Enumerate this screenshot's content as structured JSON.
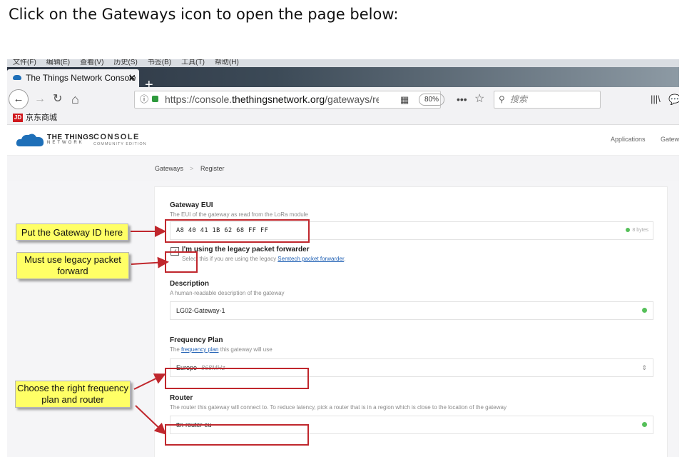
{
  "doc": {
    "heading": "Click on the Gateways icon to open the page below:"
  },
  "browser": {
    "menu": [
      "文件(F)",
      "编辑(E)",
      "查看(V)",
      "历史(S)",
      "书签(B)",
      "工具(T)",
      "帮助(H)"
    ],
    "tab": {
      "title": "The Things Network Console",
      "close": "✕"
    },
    "new_tab": "+",
    "back": "←",
    "forward": "→",
    "reload": "↻",
    "home": "⌂",
    "url": {
      "prefix": "https://console.",
      "domain": "thethingsnetwork.org",
      "path": "/gateways/regist"
    },
    "qr": "▦",
    "zoom": "80%",
    "more": "•••",
    "star": "☆",
    "search_placeholder": "搜索",
    "library": "|||\\",
    "chat": "💬",
    "bookmark": {
      "icon": "JD",
      "label": "京东商城"
    }
  },
  "header": {
    "logo_line1": "THE THINGS",
    "logo_line2": "NETWORK",
    "console": "CONSOLE",
    "edition": "COMMUNITY EDITION",
    "nav_applications": "Applications",
    "nav_gateways": "Gatew"
  },
  "breadcrumb": {
    "item1": "Gateways",
    "sep": ">",
    "item2": "Register"
  },
  "form": {
    "eui": {
      "title": "Gateway EUI",
      "desc": "The EUI of the gateway as read from the LoRa module",
      "value": "A8 40 41 1B 62 68 FF FF",
      "bytes": "8 bytes"
    },
    "legacy": {
      "check": "✓",
      "label": "I'm using the legacy packet forwarder",
      "desc_prefix": "Select this if you are using the legacy ",
      "desc_link": "Semtech packet forwarder",
      "desc_suffix": "."
    },
    "description": {
      "title": "Description",
      "desc": "A human-readable description of the gateway",
      "value": "LG02-Gateway-1"
    },
    "frequency": {
      "title": "Frequency Plan",
      "desc_prefix": "The ",
      "desc_link": "frequency plan",
      "desc_suffix": " this gateway will use",
      "value": "Europe",
      "value_hint": "868MHz",
      "arrow": "⌃⌄"
    },
    "router": {
      "title": "Router",
      "desc": "The router this gateway will connect to. To reduce latency, pick a router that is in a region which is close to the location of the gateway",
      "value": "ttn-router-eu"
    }
  },
  "annotations": {
    "gateway_id": "Put the Gateway ID here",
    "legacy": "Must use legacy packet forward",
    "frequency": "Choose the right frequency plan and router"
  },
  "colors": {
    "annotation_red": "#c0272d",
    "note_yellow": "#ffff66",
    "ttn_blue": "#1e6fb8"
  }
}
